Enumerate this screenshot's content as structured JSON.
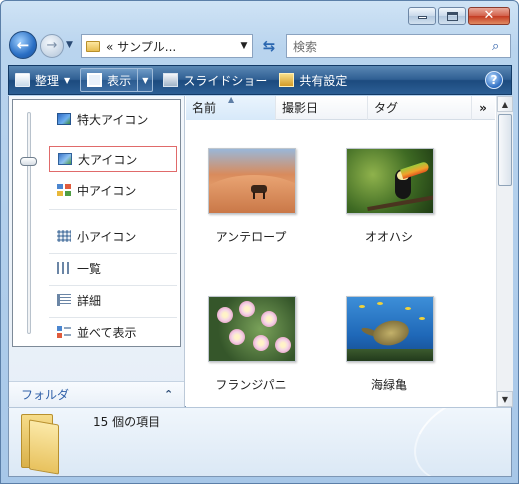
{
  "address": {
    "text": "« サンプル..."
  },
  "search": {
    "placeholder": "検索"
  },
  "toolbar": {
    "organize": "整理",
    "views": "表示",
    "slideshow": "スライドショー",
    "share": "共有設定"
  },
  "view_menu": {
    "items": [
      {
        "label": "特大アイコン",
        "icon": "extra-large-icons-icon"
      },
      {
        "label": "大アイコン",
        "icon": "large-icons-icon",
        "selected": true
      },
      {
        "label": "中アイコン",
        "icon": "medium-icons-icon"
      },
      {
        "label": "小アイコン",
        "icon": "small-icons-icon"
      },
      {
        "label": "一覧",
        "icon": "list-view-icon"
      },
      {
        "label": "詳細",
        "icon": "details-view-icon"
      },
      {
        "label": "並べて表示",
        "icon": "tiles-view-icon"
      }
    ]
  },
  "folders": {
    "label": "フォルダ"
  },
  "columns": [
    {
      "label": "名前",
      "sorted": true
    },
    {
      "label": "撮影日"
    },
    {
      "label": "タグ"
    }
  ],
  "columns_more": "»",
  "files": [
    {
      "name": "アンテロープ"
    },
    {
      "name": "オオハシ"
    },
    {
      "name": "フランジパニ"
    },
    {
      "name": "海緑亀"
    }
  ],
  "status": {
    "count_text": "15 個の項目"
  },
  "colors": {
    "command_bar": "#2f5f93",
    "selection_border": "#e06a6a",
    "folders_text": "#3060a8"
  }
}
